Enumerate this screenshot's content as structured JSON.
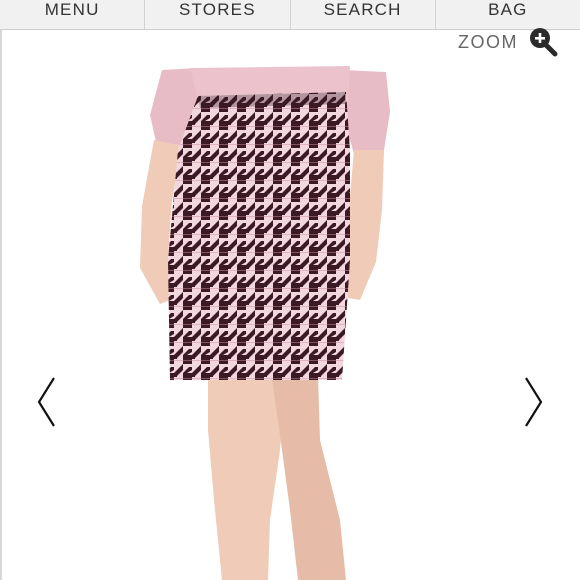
{
  "nav": {
    "items": [
      {
        "label": "MENU"
      },
      {
        "label": "STORES"
      },
      {
        "label": "SEARCH"
      },
      {
        "label": "BAG"
      }
    ]
  },
  "zoom": {
    "label": "ZOOM",
    "icon": "zoom-in-magnifier-icon"
  },
  "product_image": {
    "subject": "houndstooth-skirt",
    "colors": {
      "skirt_dark": "#3b1a26",
      "skirt_light": "#f2d7df",
      "top": "#e8bcc6",
      "skin": "#efcbb8"
    }
  },
  "carousel": {
    "prev_icon": "chevron-left-icon",
    "next_icon": "chevron-right-icon"
  }
}
